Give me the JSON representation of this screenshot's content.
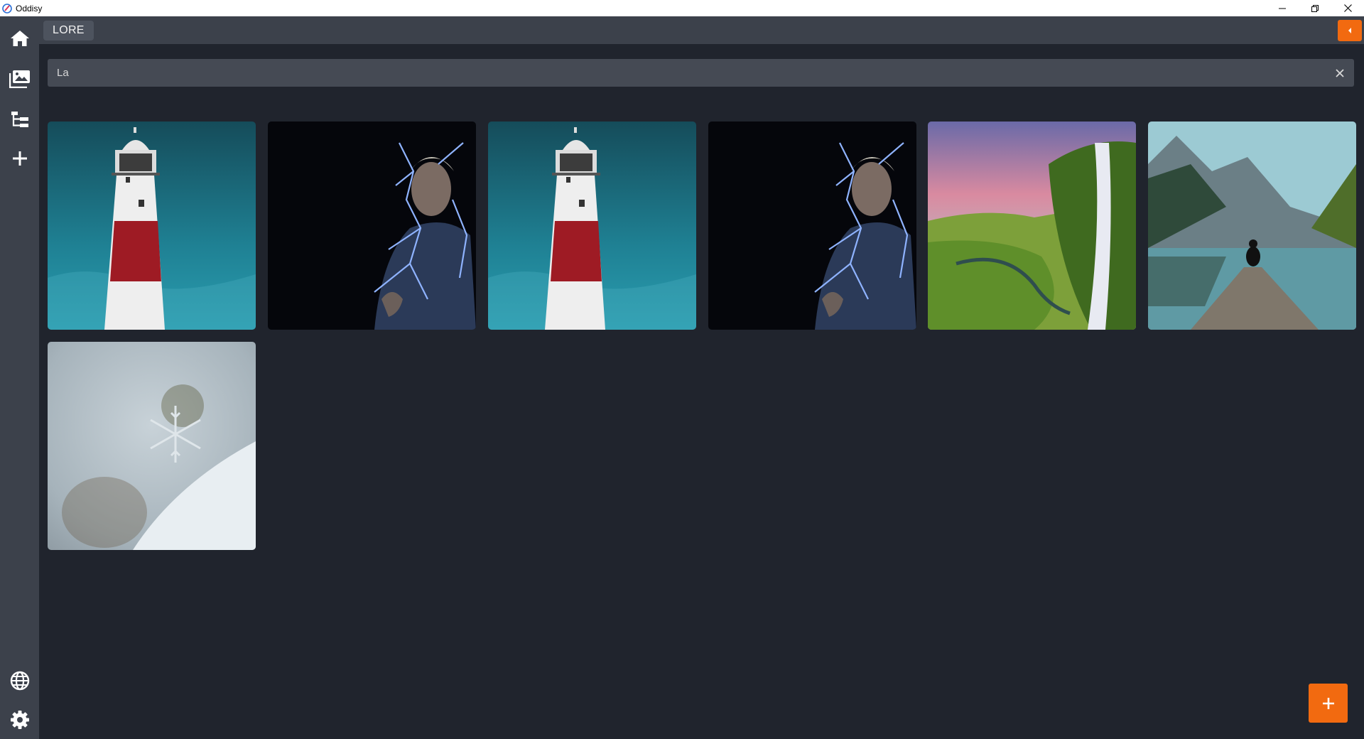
{
  "window": {
    "title": "Oddisy",
    "controls": [
      "minimize-icon",
      "restore-icon",
      "close-icon"
    ]
  },
  "sidebar": {
    "top_items": [
      {
        "icon": "home-icon"
      },
      {
        "icon": "gallery-icon"
      },
      {
        "icon": "hierarchy-icon"
      },
      {
        "icon": "plus-icon"
      }
    ],
    "bottom_items": [
      {
        "icon": "globe-icon"
      },
      {
        "icon": "gear-icon"
      }
    ]
  },
  "header": {
    "tab_label": "LORE",
    "collapse_icon": "chevron-left-icon"
  },
  "search": {
    "value": "La",
    "clear_icon": "close-icon"
  },
  "gallery": {
    "images": [
      {
        "subject": "lighthouse"
      },
      {
        "subject": "lightning-man"
      },
      {
        "subject": "lighthouse"
      },
      {
        "subject": "lightning-man"
      },
      {
        "subject": "waterfall"
      },
      {
        "subject": "lake-pier"
      },
      {
        "subject": "snowflake"
      }
    ]
  },
  "fab": {
    "icon": "plus-icon"
  },
  "colors": {
    "accent": "#f26a10",
    "background": "#20242d",
    "panel": "#3c414b",
    "input": "#454a54"
  }
}
